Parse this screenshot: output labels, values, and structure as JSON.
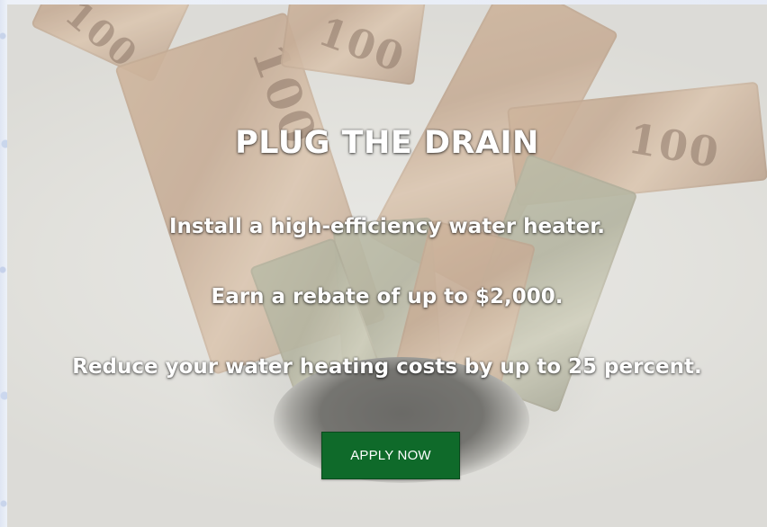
{
  "hero": {
    "headline": "PLUG THE DRAIN",
    "lines": [
      "Install a high-efficiency water heater.",
      "Earn a rebate of up to $2,000.",
      "Reduce your water heating costs by up to 25 percent."
    ],
    "cta_label": "APPLY NOW",
    "background_image": {
      "bill_text": [
        "100",
        "100",
        "100",
        "100"
      ]
    }
  },
  "colors": {
    "cta_background": "#0f6a2a",
    "text": "#ffffff",
    "frame": "#e6ebf6"
  }
}
